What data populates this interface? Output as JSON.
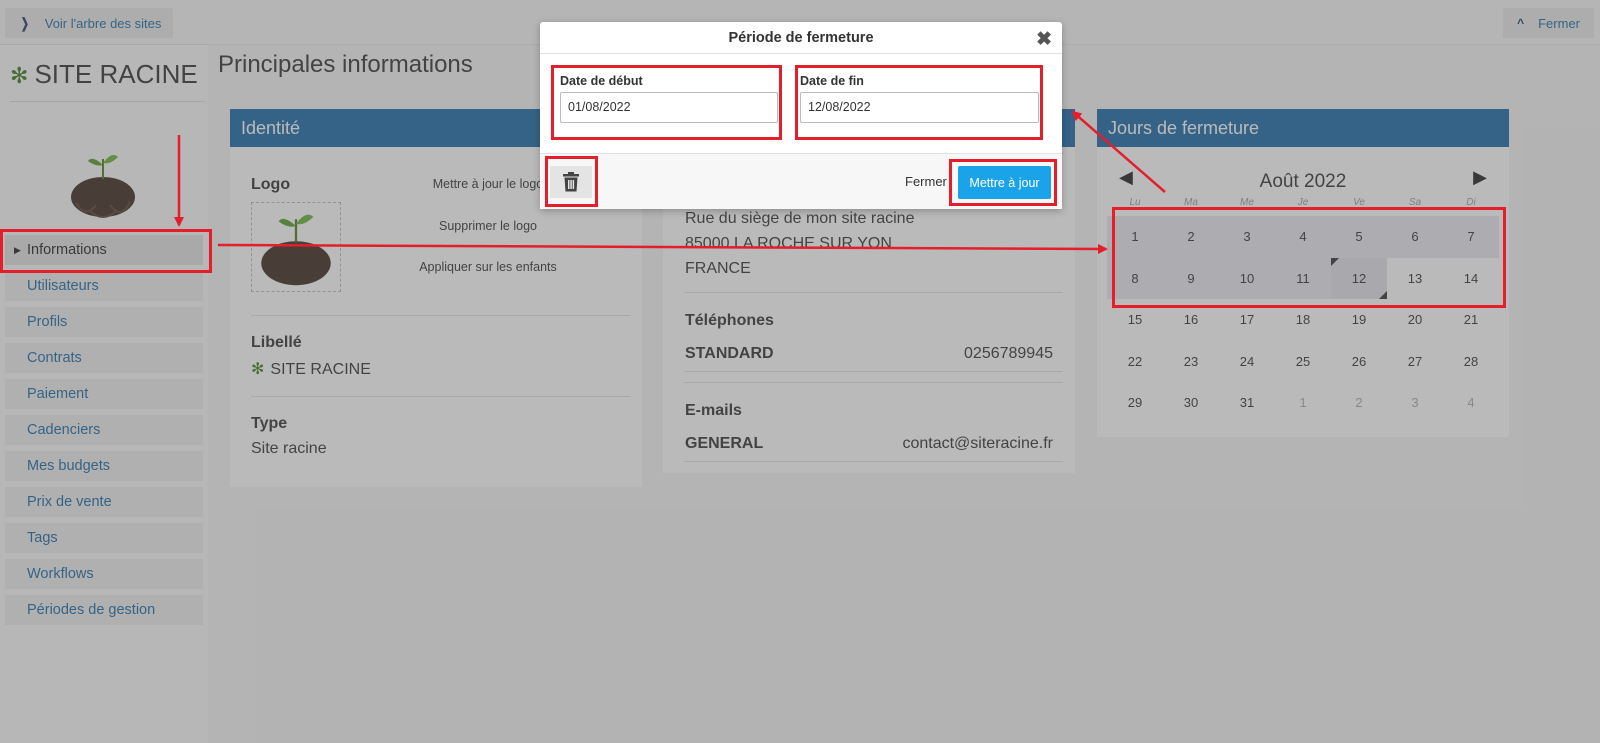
{
  "topbar": {
    "tree_label": "Voir l'arbre des sites",
    "close_label": "Fermer"
  },
  "sidebar": {
    "site_name": "SITE RACINE",
    "items": [
      {
        "label": "Informations",
        "active": true
      },
      {
        "label": "Utilisateurs"
      },
      {
        "label": "Profils"
      },
      {
        "label": "Contrats"
      },
      {
        "label": "Paiement"
      },
      {
        "label": "Cadenciers"
      },
      {
        "label": "Mes budgets"
      },
      {
        "label": "Prix de vente"
      },
      {
        "label": "Tags"
      },
      {
        "label": "Workflows"
      },
      {
        "label": "Périodes de gestion"
      }
    ]
  },
  "main": {
    "title": "Principales informations",
    "identite": {
      "header": "Identité",
      "logo_label": "Logo",
      "actions": [
        "Mettre à jour le logo",
        "Supprimer le logo",
        "Appliquer sur les enfants"
      ],
      "libelle_label": "Libellé",
      "libelle_value": "SITE RACINE",
      "type_label": "Type",
      "type_value": "Site racine"
    },
    "coordonnees": {
      "address": [
        "Rue du siège de mon site racine",
        "85000 LA ROCHE SUR YON",
        "FRANCE"
      ],
      "phones_label": "Téléphones",
      "phone_key": "STANDARD",
      "phone_value": "0256789945",
      "emails_label": "E-mails",
      "email_key": "GENERAL",
      "email_value": "contact@siteracine.fr"
    },
    "jours": {
      "header": "Jours de fermeture",
      "month": "Août 2022",
      "dow": [
        "Lu",
        "Ma",
        "Me",
        "Je",
        "Ve",
        "Sa",
        "Di"
      ],
      "days": [
        "1",
        "2",
        "3",
        "4",
        "5",
        "6",
        "7",
        "8",
        "9",
        "10",
        "11",
        "12",
        "13",
        "14",
        "15",
        "16",
        "17",
        "18",
        "19",
        "20",
        "21",
        "22",
        "23",
        "24",
        "25",
        "26",
        "27",
        "28",
        "29",
        "30",
        "31",
        "1",
        "2",
        "3",
        "4"
      ],
      "selected_range": [
        1,
        12
      ]
    }
  },
  "modal": {
    "title": "Période de fermeture",
    "start_label": "Date de début",
    "start_value": "01/08/2022",
    "end_label": "Date de fin",
    "end_value": "12/08/2022",
    "close_label": "Fermer",
    "update_label": "Mettre à jour"
  },
  "colors": {
    "header_blue": "#1a6aa8",
    "button_blue": "#1ba3ea",
    "annotation_red": "#e41e2b"
  }
}
